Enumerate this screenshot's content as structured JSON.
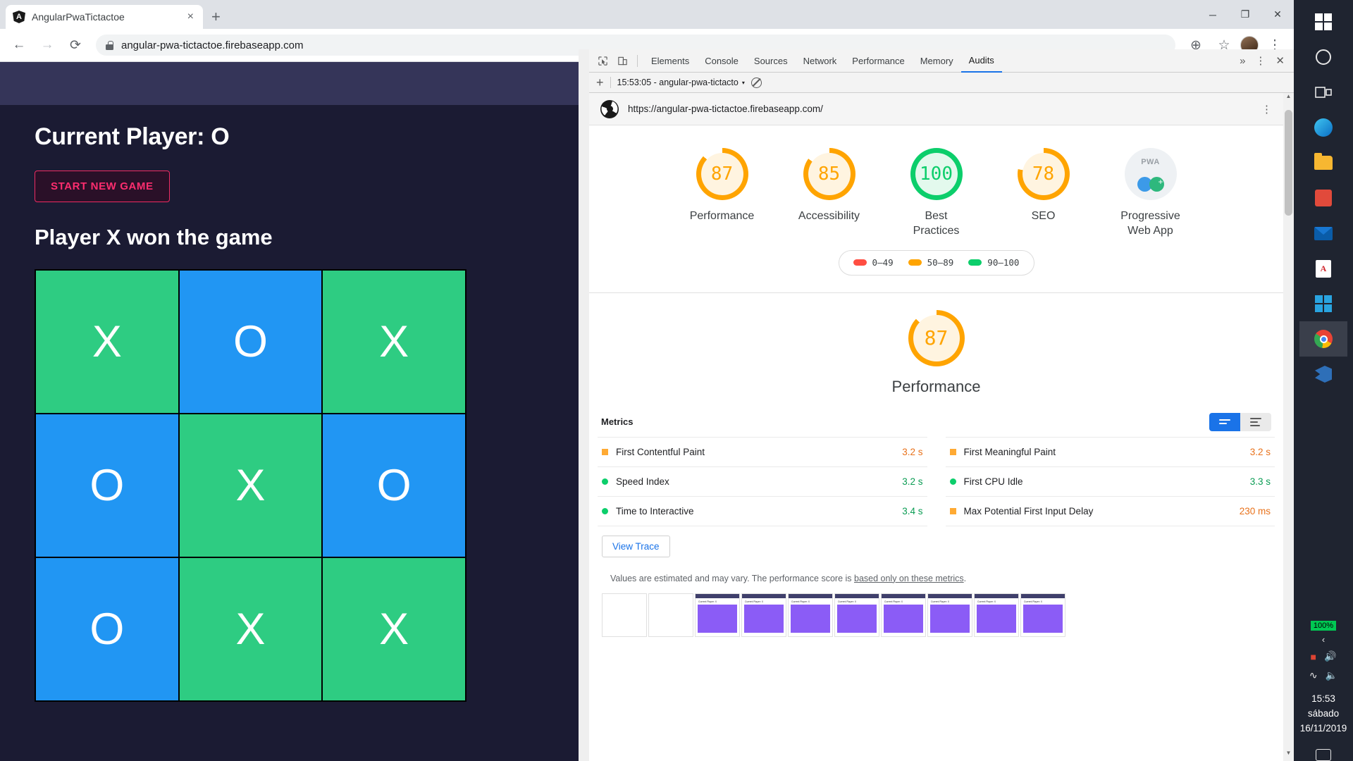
{
  "browser": {
    "tab": {
      "title": "AngularPwaTictactoe",
      "favicon": "angular-logo-icon",
      "close": "×"
    },
    "new_tab": "+",
    "window_controls": {
      "minimize": "─",
      "maximize": "❐",
      "close": "✕"
    },
    "nav": {
      "back": "←",
      "forward": "→",
      "reload": "⟳"
    },
    "omnibox": {
      "url": "angular-pwa-tictactoe.firebaseapp.com",
      "lock": "lock-icon"
    },
    "toolbar_right": {
      "install": "⊕",
      "bookmark": "☆",
      "menu": "⋮"
    }
  },
  "app": {
    "current_player_heading": "Current Player: O",
    "start_button": "START NEW GAME",
    "winner_heading": "Player X won the game",
    "board": [
      {
        "mark": "X",
        "color": "g"
      },
      {
        "mark": "O",
        "color": "b"
      },
      {
        "mark": "X",
        "color": "g"
      },
      {
        "mark": "O",
        "color": "b"
      },
      {
        "mark": "X",
        "color": "g"
      },
      {
        "mark": "O",
        "color": "b"
      },
      {
        "mark": "O",
        "color": "b"
      },
      {
        "mark": "X",
        "color": "g"
      },
      {
        "mark": "X",
        "color": "g"
      }
    ]
  },
  "devtools": {
    "inspect_icon": "cursor-inspect-icon",
    "device_icon": "device-toolbar-icon",
    "tabs": [
      {
        "label": "Elements",
        "active": false
      },
      {
        "label": "Console",
        "active": false
      },
      {
        "label": "Sources",
        "active": false
      },
      {
        "label": "Network",
        "active": false
      },
      {
        "label": "Performance",
        "active": false
      },
      {
        "label": "Memory",
        "active": false
      },
      {
        "label": "Audits",
        "active": true
      }
    ],
    "overflow": "»",
    "settings": "⋮",
    "close": "✕",
    "subbar": {
      "add": "+",
      "run_label": "15:53:05 - angular-pwa-tictacto",
      "caret": "▾",
      "clear": "clear-icon"
    }
  },
  "report": {
    "url": "https://angular-pwa-tictactoe.firebaseapp.com/",
    "kebab": "⋮",
    "gauges": [
      {
        "score": "87",
        "label": "Performance",
        "color": "#ffa400",
        "bg": "#fff4e0",
        "pct": 87
      },
      {
        "score": "85",
        "label": "Accessibility",
        "color": "#ffa400",
        "bg": "#fff4e0",
        "pct": 85
      },
      {
        "score": "100",
        "label": "Best\nPractices",
        "color": "#0cce6b",
        "bg": "#e3f9ed",
        "pct": 100
      },
      {
        "score": "78",
        "label": "SEO",
        "color": "#ffa400",
        "bg": "#fff4e0",
        "pct": 78
      }
    ],
    "pwa": {
      "label": "Progressive\nWeb App",
      "badge_text": "PWA"
    },
    "legend": [
      {
        "range": "0–49",
        "color": "#ff4e42"
      },
      {
        "range": "50–89",
        "color": "#ffa400"
      },
      {
        "range": "90–100",
        "color": "#0cce6b"
      }
    ],
    "performance_hero": {
      "score": "87",
      "title": "Performance",
      "color": "#ffa400",
      "bg": "#fff4e0",
      "pct": 87
    },
    "metrics_title": "Metrics",
    "metrics": [
      {
        "name": "First Contentful Paint",
        "value": "3.2 s",
        "status": "avg"
      },
      {
        "name": "First Meaningful Paint",
        "value": "3.2 s",
        "status": "avg"
      },
      {
        "name": "Speed Index",
        "value": "3.2 s",
        "status": "pass"
      },
      {
        "name": "First CPU Idle",
        "value": "3.3 s",
        "status": "pass"
      },
      {
        "name": "Time to Interactive",
        "value": "3.4 s",
        "status": "pass"
      },
      {
        "name": "Max Potential First Input Delay",
        "value": "230 ms",
        "status": "avg"
      }
    ],
    "view_trace": "View Trace",
    "disclaimer_prefix": "Values are estimated and may vary. The performance score is ",
    "disclaimer_link": "based only on these metrics",
    "disclaimer_suffix": ".",
    "filmstrip_caption": "Current Player: X"
  },
  "taskbar": {
    "items": [
      {
        "name": "start-button",
        "icon": "windows-logo-icon"
      },
      {
        "name": "cortana-button",
        "icon": "circle-icon"
      },
      {
        "name": "task-view-button",
        "icon": "task-view-icon"
      },
      {
        "name": "edge-app",
        "icon": "edge-icon"
      },
      {
        "name": "file-explorer-app",
        "icon": "folder-icon"
      },
      {
        "name": "store-app",
        "icon": "store-icon"
      },
      {
        "name": "mail-app",
        "icon": "mail-icon"
      },
      {
        "name": "acrobat-app",
        "icon": "pdf-icon"
      },
      {
        "name": "microsoft-app",
        "icon": "windows-logo-icon"
      },
      {
        "name": "chrome-app",
        "icon": "chrome-icon"
      },
      {
        "name": "vscode-app",
        "icon": "vscode-icon"
      }
    ],
    "battery_badge": "100%",
    "tray_caret": "‹",
    "clock": {
      "time": "15:53",
      "weekday": "sábado",
      "date": "16/11/2019"
    }
  }
}
